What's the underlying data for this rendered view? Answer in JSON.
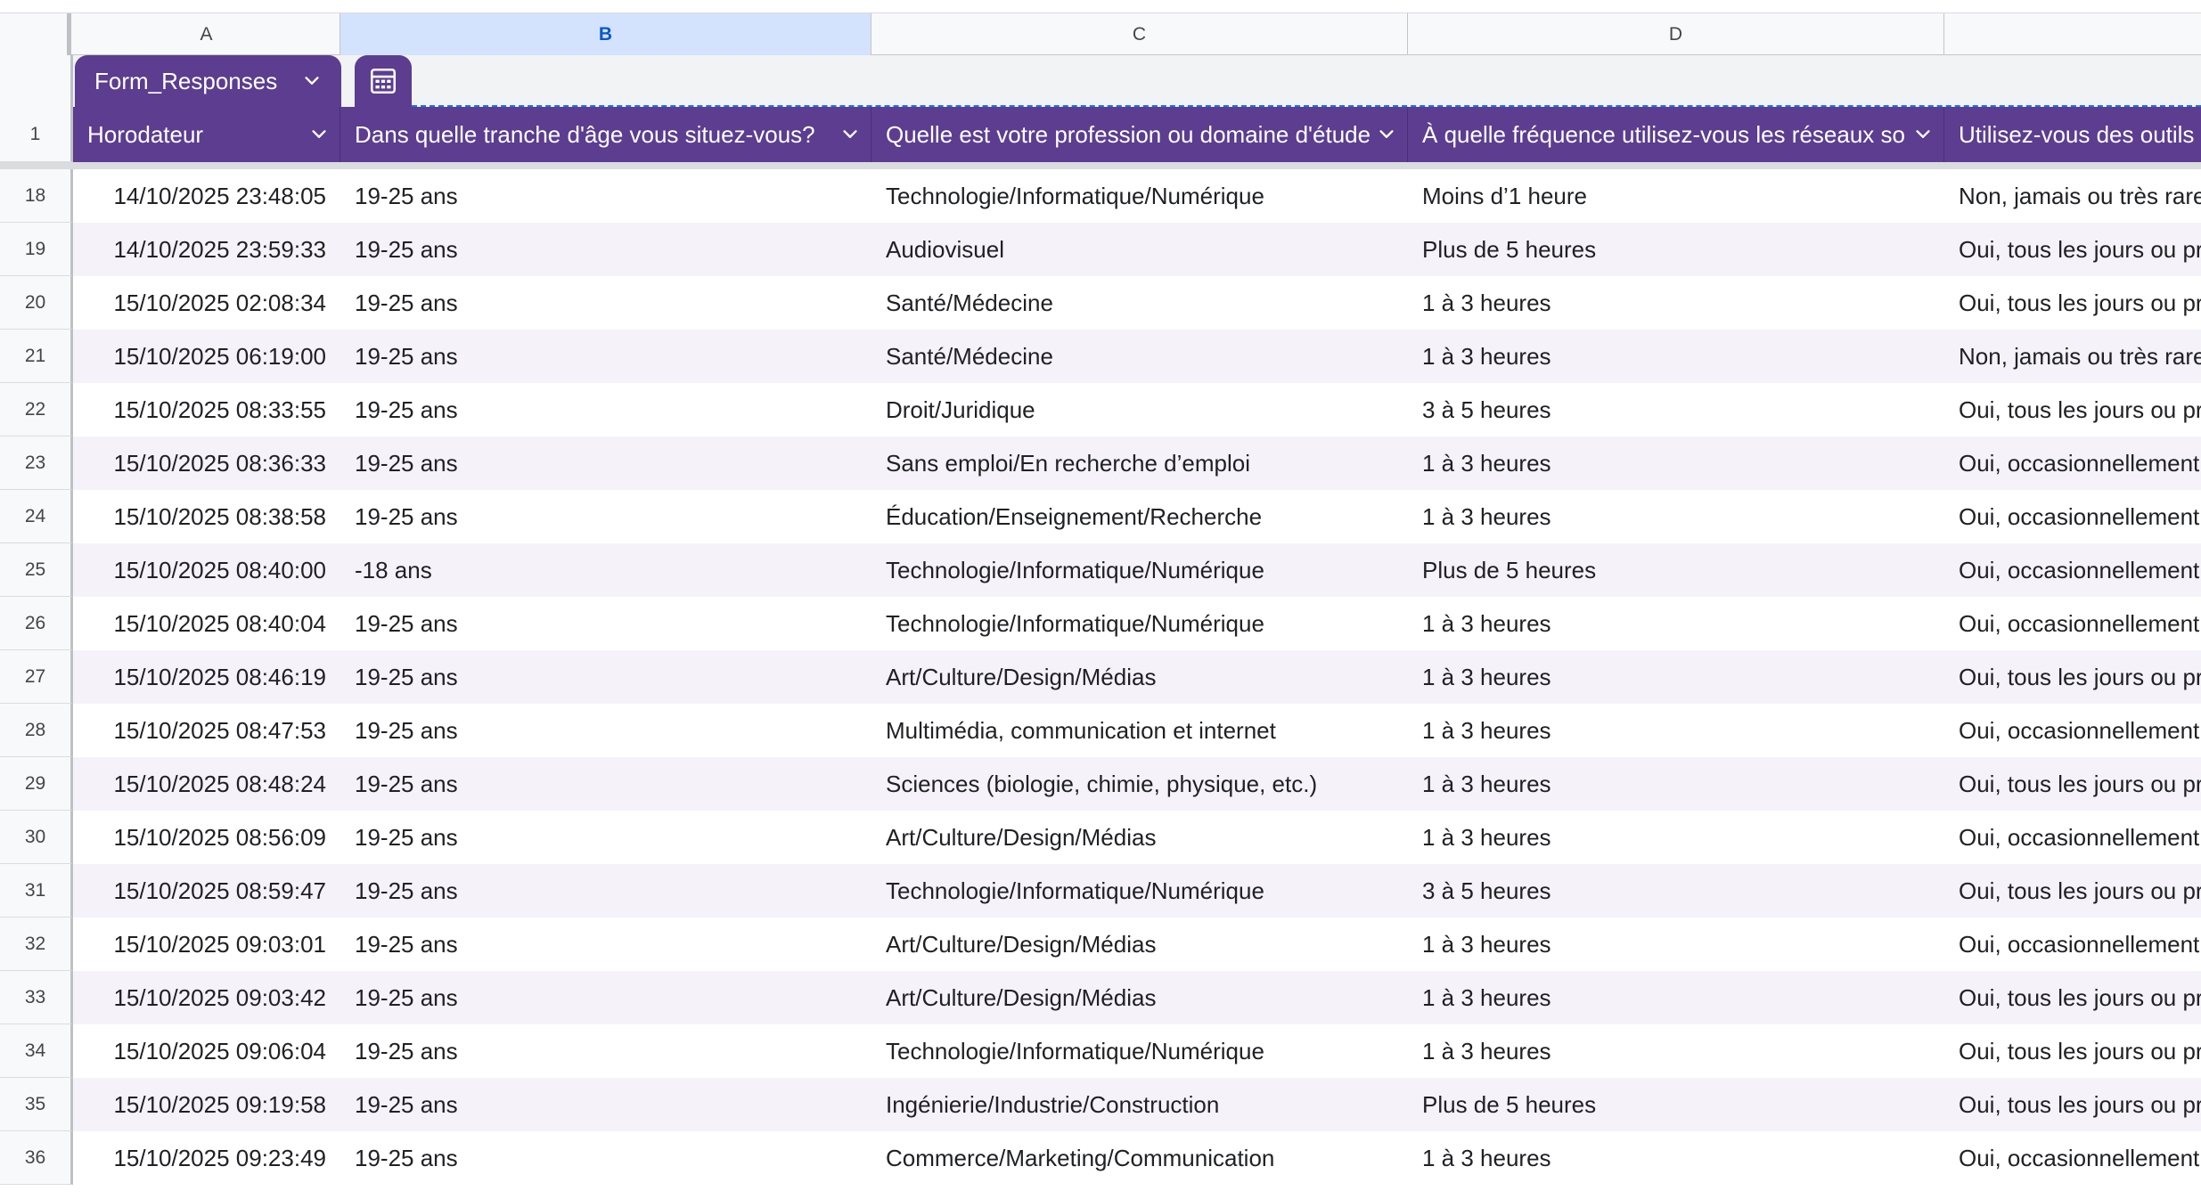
{
  "columns": {
    "letters": [
      "A",
      "B",
      "C",
      "D",
      ""
    ],
    "selected": "B"
  },
  "table": {
    "tab_label": "Form_Responses",
    "tab_icon": "table-calculator-icon",
    "header_row_number": "1",
    "headers": [
      "Horodateur",
      "Dans quelle tranche d'âge vous situez-vous?",
      "Quelle est votre profession ou domaine d'étude",
      "À quelle fréquence utilisez-vous les réseaux so",
      "Utilisez-vous des outils"
    ],
    "header_fill": "#5c3d8f",
    "stripe_fill": "#f5f3f9"
  },
  "rows": [
    {
      "n": "18",
      "cells": [
        "14/10/2025 23:48:05",
        "19-25 ans",
        "Technologie/Informatique/Numérique",
        "Moins d’1 heure",
        "Non, jamais ou très rare"
      ]
    },
    {
      "n": "19",
      "cells": [
        "14/10/2025 23:59:33",
        "19-25 ans",
        "Audiovisuel",
        "Plus de 5 heures",
        "Oui, tous les jours ou pr"
      ]
    },
    {
      "n": "20",
      "cells": [
        "15/10/2025 02:08:34",
        "19-25 ans",
        "Santé/Médecine",
        "1 à 3 heures",
        "Oui, tous les jours ou pr"
      ]
    },
    {
      "n": "21",
      "cells": [
        "15/10/2025 06:19:00",
        "19-25 ans",
        "Santé/Médecine",
        "1 à 3 heures",
        "Non, jamais ou très rare"
      ]
    },
    {
      "n": "22",
      "cells": [
        "15/10/2025 08:33:55",
        "19-25 ans",
        "Droit/Juridique",
        "3 à 5 heures",
        "Oui, tous les jours ou pr"
      ]
    },
    {
      "n": "23",
      "cells": [
        "15/10/2025 08:36:33",
        "19-25 ans",
        "Sans emploi/En recherche d’emploi",
        "1 à 3 heures",
        "Oui, occasionnellement"
      ]
    },
    {
      "n": "24",
      "cells": [
        "15/10/2025 08:38:58",
        "19-25 ans",
        "Éducation/Enseignement/Recherche",
        "1 à 3 heures",
        "Oui, occasionnellement"
      ]
    },
    {
      "n": "25",
      "cells": [
        "15/10/2025 08:40:00",
        "-18 ans",
        "Technologie/Informatique/Numérique",
        "Plus de 5 heures",
        "Oui, occasionnellement"
      ]
    },
    {
      "n": "26",
      "cells": [
        "15/10/2025 08:40:04",
        "19-25 ans",
        "Technologie/Informatique/Numérique",
        "1 à 3 heures",
        "Oui, occasionnellement"
      ]
    },
    {
      "n": "27",
      "cells": [
        "15/10/2025 08:46:19",
        "19-25 ans",
        "Art/Culture/Design/Médias",
        "1 à 3 heures",
        "Oui, tous les jours ou pr"
      ]
    },
    {
      "n": "28",
      "cells": [
        "15/10/2025 08:47:53",
        "19-25 ans",
        "Multimédia, communication et internet",
        "1 à 3 heures",
        "Oui, occasionnellement"
      ]
    },
    {
      "n": "29",
      "cells": [
        "15/10/2025 08:48:24",
        "19-25 ans",
        "Sciences (biologie, chimie, physique, etc.)",
        "1 à 3 heures",
        "Oui, tous les jours ou pr"
      ]
    },
    {
      "n": "30",
      "cells": [
        "15/10/2025 08:56:09",
        "19-25 ans",
        "Art/Culture/Design/Médias",
        "1 à 3 heures",
        "Oui, occasionnellement"
      ]
    },
    {
      "n": "31",
      "cells": [
        "15/10/2025 08:59:47",
        "19-25 ans",
        "Technologie/Informatique/Numérique",
        "3 à 5 heures",
        "Oui, tous les jours ou pr"
      ]
    },
    {
      "n": "32",
      "cells": [
        "15/10/2025 09:03:01",
        "19-25 ans",
        "Art/Culture/Design/Médias",
        "1 à 3 heures",
        "Oui, occasionnellement"
      ]
    },
    {
      "n": "33",
      "cells": [
        "15/10/2025 09:03:42",
        "19-25 ans",
        "Art/Culture/Design/Médias",
        "1 à 3 heures",
        "Oui, tous les jours ou pr"
      ]
    },
    {
      "n": "34",
      "cells": [
        "15/10/2025 09:06:04",
        "19-25 ans",
        "Technologie/Informatique/Numérique",
        "1 à 3 heures",
        "Oui, tous les jours ou pr"
      ]
    },
    {
      "n": "35",
      "cells": [
        "15/10/2025 09:19:58",
        "19-25 ans",
        "Ingénierie/Industrie/Construction",
        "Plus de 5 heures",
        "Oui, tous les jours ou pr"
      ]
    },
    {
      "n": "36",
      "cells": [
        "15/10/2025 09:23:49",
        "19-25 ans",
        "Commerce/Marketing/Communication",
        "1 à 3 heures",
        "Oui, occasionnellement"
      ]
    }
  ]
}
